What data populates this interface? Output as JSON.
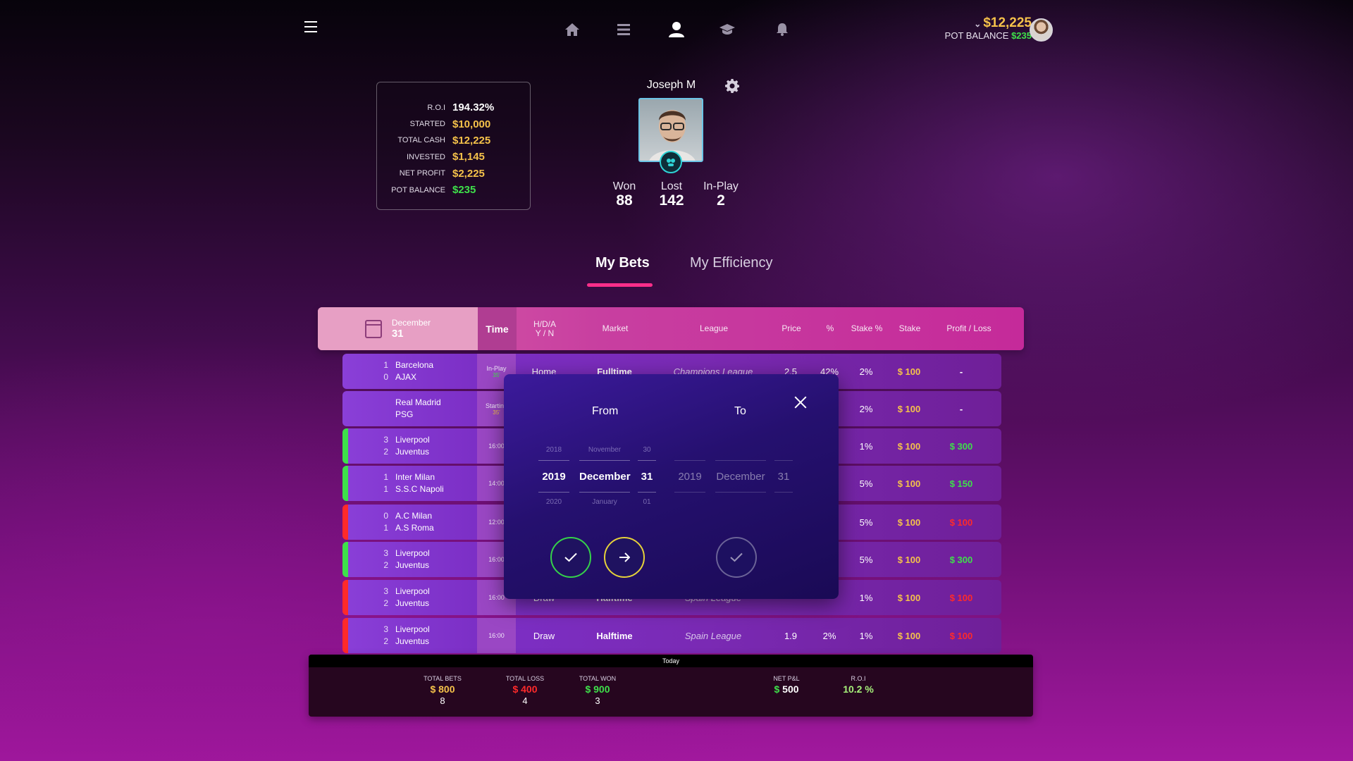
{
  "nav": {
    "icons": [
      "home-icon",
      "list-icon",
      "user-icon",
      "graduation-cap-icon",
      "bell-icon"
    ],
    "balance": "$12,225",
    "pot_label": "POT BALANCE",
    "pot_value": "$235"
  },
  "stats": [
    {
      "label": "R.O.I",
      "value": "194.32%",
      "color": "white"
    },
    {
      "label": "STARTED",
      "value": "$10,000",
      "color": "gold"
    },
    {
      "label": "TOTAL CASH",
      "value": "$12,225",
      "color": "gold"
    },
    {
      "label": "INVESTED",
      "value": "$1,145",
      "color": "gold"
    },
    {
      "label": "NET PROFIT",
      "value": "$2,225",
      "color": "gold"
    },
    {
      "label": "POT BALANCE",
      "value": "$235",
      "color": "green"
    }
  ],
  "profile": {
    "name": "Joseph M",
    "won_label": "Won",
    "won": "88",
    "lost_label": "Lost",
    "lost": "142",
    "inplay_label": "In-Play",
    "inplay": "2"
  },
  "tabs": {
    "my_bets": "My Bets",
    "my_efficiency": "My Efficiency"
  },
  "table": {
    "date_month": "December",
    "date_day": "31",
    "headers": {
      "time": "Time",
      "hda_1": "H/D/A",
      "hda_2": "Y / N",
      "market": "Market",
      "league": "League",
      "price": "Price",
      "pct": "%",
      "stake_pct": "Stake %",
      "stake": "Stake",
      "pl": "Profit / Loss"
    },
    "rows": [
      {
        "s1": "1",
        "t1": "Barcelona",
        "s2": "0",
        "t2": "AJAX",
        "time": "In-Play",
        "time_sub": "35'",
        "hda": "Home",
        "market": "Fulltime",
        "league": "Champions League",
        "price": "2.5",
        "pct": "42%",
        "stake_pct": "2%",
        "stake": "$ 100",
        "pl": "-",
        "status": "none"
      },
      {
        "s1": "",
        "t1": "Real Madrid",
        "s2": "",
        "t2": "PSG",
        "time": "Starting",
        "time_sub": "35'",
        "hda": "",
        "market": "",
        "league": "",
        "price": "",
        "pct": "",
        "stake_pct": "2%",
        "stake": "$ 100",
        "pl": "-",
        "status": "none"
      },
      {
        "s1": "3",
        "t1": "Liverpool",
        "s2": "2",
        "t2": "Juventus",
        "time": "16:00",
        "time_sub": "",
        "hda": "",
        "market": "",
        "league": "",
        "price": "",
        "pct": "",
        "stake_pct": "1%",
        "stake": "$ 100",
        "pl": "$ 300",
        "status": "win"
      },
      {
        "s1": "1",
        "t1": "Inter Milan",
        "s2": "1",
        "t2": "S.S.C Napoli",
        "time": "14:00",
        "time_sub": "",
        "hda": "",
        "market": "",
        "league": "",
        "price": "",
        "pct": "",
        "stake_pct": "5%",
        "stake": "$ 100",
        "pl": "$ 150",
        "status": "win"
      },
      {
        "s1": "0",
        "t1": "A.C Milan",
        "s2": "1",
        "t2": "A.S Roma",
        "time": "12:00",
        "time_sub": "",
        "hda": "",
        "market": "",
        "league": "",
        "price": "",
        "pct": "",
        "stake_pct": "5%",
        "stake": "$ 100",
        "pl": "$ 100",
        "status": "loss"
      },
      {
        "s1": "3",
        "t1": "Liverpool",
        "s2": "2",
        "t2": "Juventus",
        "time": "16:00",
        "time_sub": "",
        "hda": "",
        "market": "",
        "league": "",
        "price": "",
        "pct": "",
        "stake_pct": "5%",
        "stake": "$ 100",
        "pl": "$ 300",
        "status": "win"
      },
      {
        "s1": "3",
        "t1": "Liverpool",
        "s2": "2",
        "t2": "Juventus",
        "time": "16:00",
        "time_sub": "",
        "hda": "Draw",
        "market": "Halftime",
        "league": "Spain League",
        "price": "",
        "pct": "",
        "stake_pct": "1%",
        "stake": "$ 100",
        "pl": "$ 100",
        "status": "loss"
      },
      {
        "s1": "3",
        "t1": "Liverpool",
        "s2": "2",
        "t2": "Juventus",
        "time": "16:00",
        "time_sub": "",
        "hda": "Draw",
        "market": "Halftime",
        "league": "Spain League",
        "price": "1.9",
        "pct": "2%",
        "stake_pct": "1%",
        "stake": "$ 100",
        "pl": "$ 100",
        "status": "loss"
      }
    ]
  },
  "summary": {
    "bar_label": "Today",
    "total_bets_label": "TOTAL BETS",
    "total_bets_value": "$ 800",
    "total_bets_count": "8",
    "total_loss_label": "TOTAL LOSS",
    "total_loss_value": "$ 400",
    "total_loss_count": "4",
    "total_won_label": "TOTAL WON",
    "total_won_value": "$ 900",
    "total_won_count": "3",
    "net_label": "NET P&L",
    "net_value": "$ 500",
    "roi_label": "R.O.I",
    "roi_value": "10.2 %"
  },
  "modal": {
    "from_label": "From",
    "to_label": "To",
    "from": {
      "year_prev": "2018",
      "year": "2019",
      "year_next": "2020",
      "month_prev": "November",
      "month": "December",
      "month_next": "January",
      "day_prev": "30",
      "day": "31",
      "day_next": "01"
    },
    "to": {
      "year": "2019",
      "month": "December",
      "day": "31"
    }
  },
  "colors": {
    "gold": "#f5c24a",
    "green": "#3ee04a",
    "red": "#ff2a2a",
    "accent": "#ff2e8a"
  }
}
